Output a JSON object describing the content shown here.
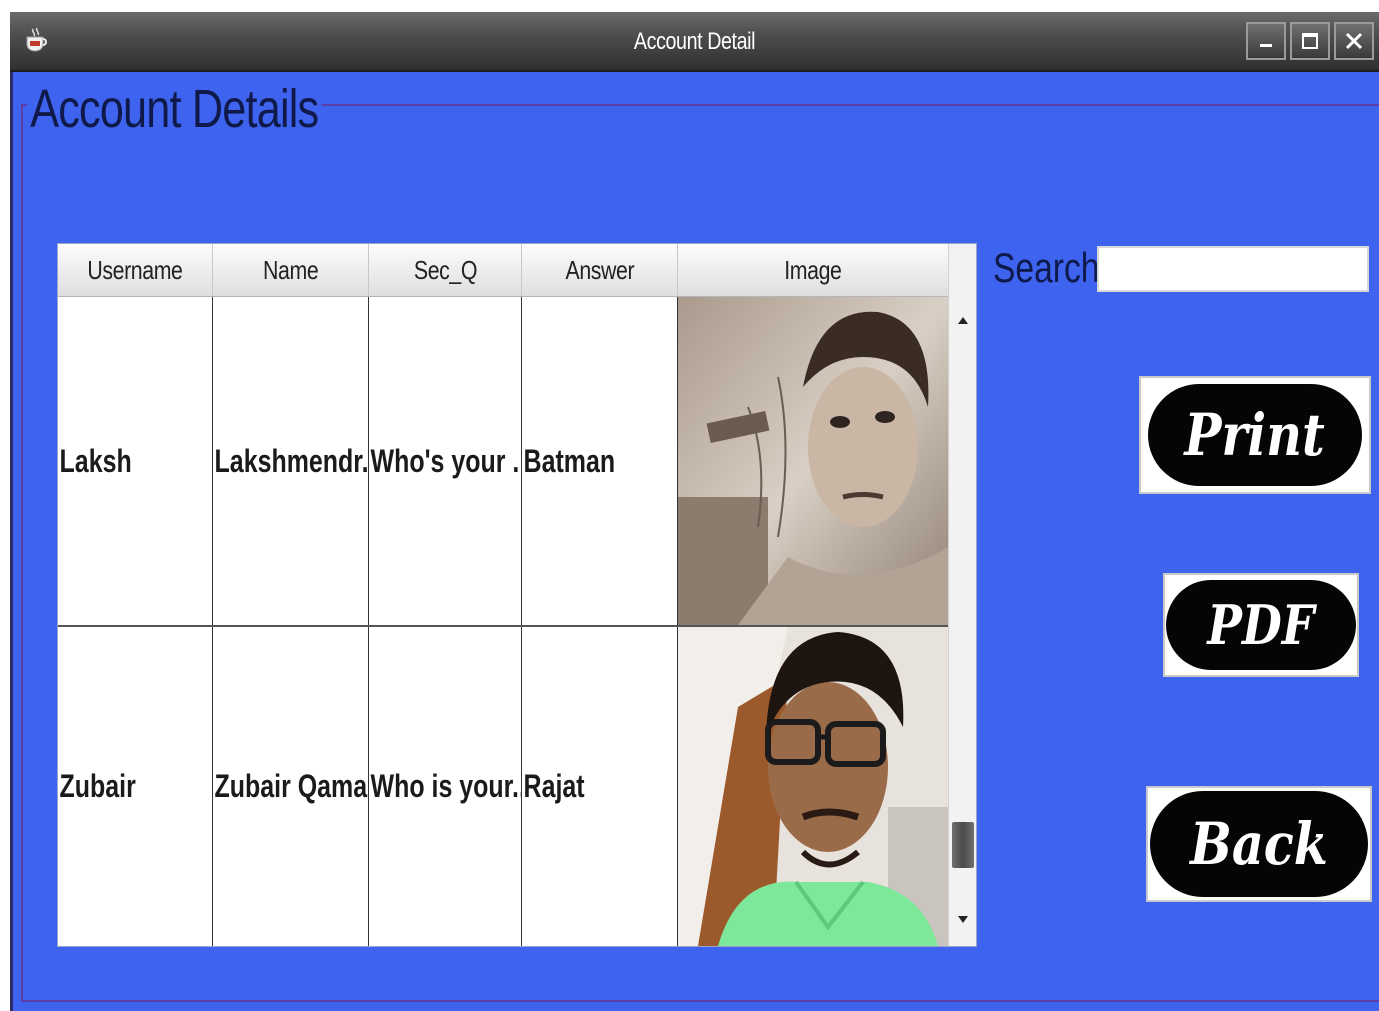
{
  "window": {
    "title": "Account Detail"
  },
  "panel": {
    "title": "Account Details"
  },
  "table": {
    "columns": [
      "Username",
      "Name",
      "Sec_Q",
      "Answer",
      "Image"
    ],
    "rows": [
      {
        "username": "Laksh",
        "name": "Lakshmendr...",
        "sec_q": "Who's your ...",
        "answer": "Batman",
        "image": "profile-photo"
      },
      {
        "username": "Zubair",
        "name": "Zubair Qamar",
        "sec_q": "Who is your...",
        "answer": "Rajat",
        "image": "profile-photo"
      }
    ]
  },
  "search": {
    "label": "Search",
    "value": "",
    "placeholder": ""
  },
  "buttons": {
    "print": "Print",
    "pdf": "PDF",
    "back": "Back"
  },
  "icons": {
    "app": "coffee-cup-icon",
    "minimize": "minimize-icon",
    "maximize": "maximize-icon",
    "close": "close-icon",
    "scroll_up": "chevron-up-icon",
    "scroll_down": "chevron-down-icon"
  },
  "colors": {
    "content_background": "#3d63ef",
    "button_background": "#050505"
  }
}
